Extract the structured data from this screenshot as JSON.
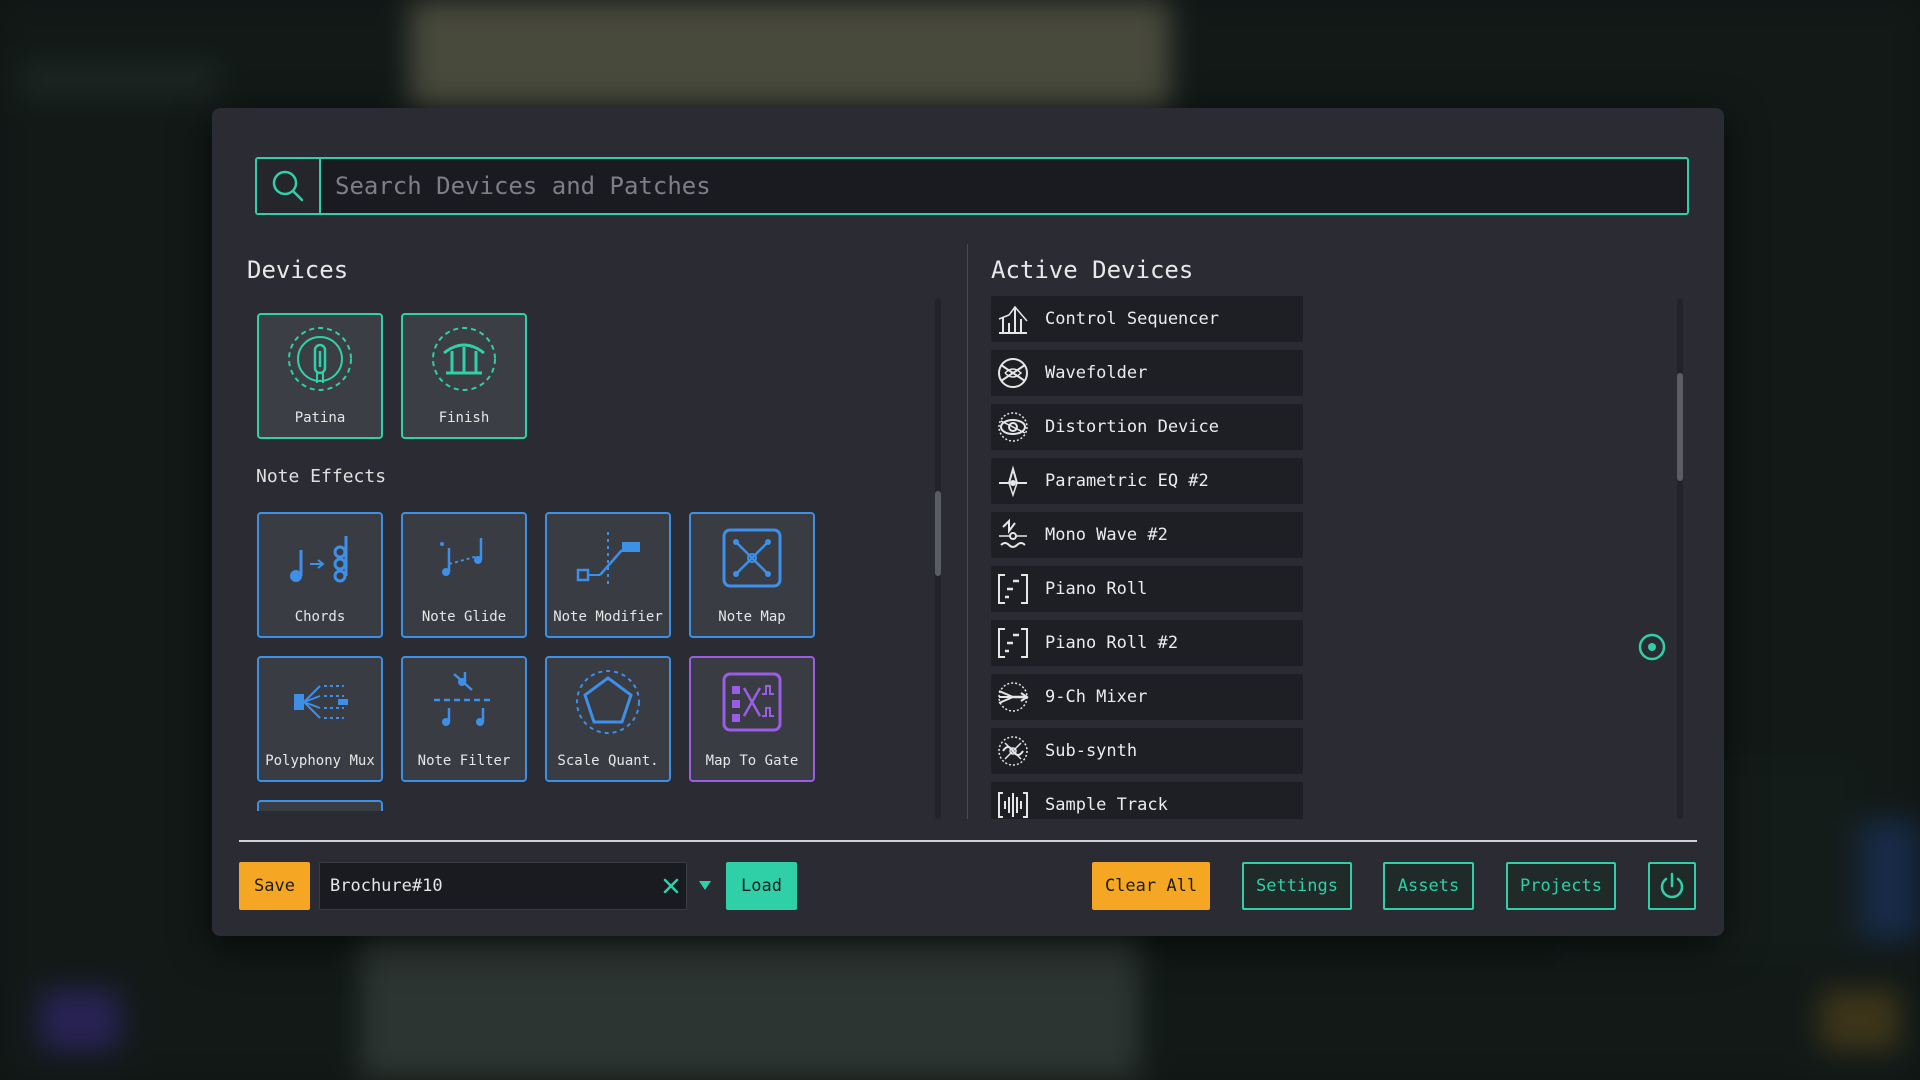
{
  "colors": {
    "accent": "#2fd0a8",
    "note_blue": "#3d8fe8",
    "gate_purple": "#9b5de5",
    "orange": "#f5a623",
    "panel": "#2a2b33"
  },
  "search": {
    "placeholder": "Search Devices and Patches",
    "value": "",
    "icon": "search-icon"
  },
  "devices": {
    "title": "Devices",
    "items": [
      {
        "label": "Patina",
        "icon": "patina-icon"
      },
      {
        "label": "Finish",
        "icon": "finish-icon"
      }
    ]
  },
  "note_effects": {
    "title": "Note Effects",
    "items": [
      {
        "label": "Chords",
        "icon": "chords-icon"
      },
      {
        "label": "Note Glide",
        "icon": "note-glide-icon"
      },
      {
        "label": "Note Modifier",
        "icon": "note-modifier-icon"
      },
      {
        "label": "Note Map",
        "icon": "note-map-icon"
      },
      {
        "label": "Polyphony Mux",
        "icon": "polyphony-mux-icon"
      },
      {
        "label": "Note Filter",
        "icon": "note-filter-icon"
      },
      {
        "label": "Scale Quant.",
        "icon": "scale-quant-icon"
      },
      {
        "label": "Map To Gate",
        "icon": "map-to-gate-icon"
      }
    ]
  },
  "active_devices": {
    "title": "Active Devices",
    "items": [
      {
        "label": "Control Sequencer",
        "icon": "control-sequencer-icon"
      },
      {
        "label": "Wavefolder",
        "icon": "wavefolder-icon"
      },
      {
        "label": "Distortion Device",
        "icon": "distortion-icon"
      },
      {
        "label": "Parametric EQ #2",
        "icon": "parametric-eq-icon"
      },
      {
        "label": "Mono Wave #2",
        "icon": "mono-wave-icon"
      },
      {
        "label": "Piano Roll",
        "icon": "piano-roll-icon"
      },
      {
        "label": "Piano Roll #2",
        "icon": "piano-roll-icon"
      },
      {
        "label": "9-Ch Mixer",
        "icon": "mixer-icon"
      },
      {
        "label": "Sub-synth",
        "icon": "sub-synth-icon"
      },
      {
        "label": "Sample Track",
        "icon": "sample-track-icon"
      }
    ]
  },
  "footer": {
    "save_label": "Save",
    "patch_name": "Brochure#10",
    "load_label": "Load",
    "clear_all_label": "Clear All",
    "settings_label": "Settings",
    "assets_label": "Assets",
    "projects_label": "Projects"
  }
}
